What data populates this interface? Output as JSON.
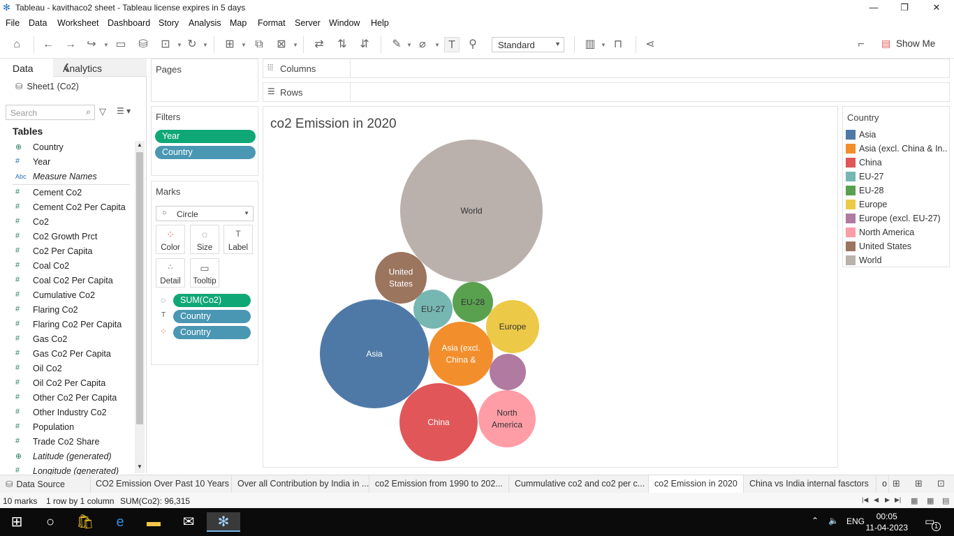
{
  "window": {
    "title": "Tableau - kavithaco2 sheet - Tableau license expires in 5 days"
  },
  "menu": [
    "File",
    "Data",
    "Worksheet",
    "Dashboard",
    "Story",
    "Analysis",
    "Map",
    "Format",
    "Server",
    "Window",
    "Help"
  ],
  "toolbar": {
    "fit_select": "Standard",
    "show_me": "Show Me"
  },
  "data_pane": {
    "tab_data": "Data",
    "tab_analytics": "Analytics",
    "datasource": "Sheet1 (Co2)",
    "search_placeholder": "Search",
    "tables_heading": "Tables",
    "fields": [
      {
        "icon": "globe",
        "name": "Country"
      },
      {
        "icon": "#",
        "name": "Year"
      },
      {
        "icon": "Abc",
        "name": "Measure Names"
      },
      {
        "icon": "#",
        "name": "Cement Co2"
      },
      {
        "icon": "#",
        "name": "Cement Co2 Per Capita"
      },
      {
        "icon": "#",
        "name": "Co2"
      },
      {
        "icon": "#",
        "name": "Co2 Growth Prct"
      },
      {
        "icon": "#",
        "name": "Co2 Per Capita"
      },
      {
        "icon": "#",
        "name": "Coal Co2"
      },
      {
        "icon": "#",
        "name": "Coal Co2 Per Capita"
      },
      {
        "icon": "#",
        "name": "Cumulative Co2"
      },
      {
        "icon": "#",
        "name": "Flaring Co2"
      },
      {
        "icon": "#",
        "name": "Flaring Co2 Per Capita"
      },
      {
        "icon": "#",
        "name": "Gas Co2"
      },
      {
        "icon": "#",
        "name": "Gas Co2 Per Capita"
      },
      {
        "icon": "#",
        "name": "Oil Co2"
      },
      {
        "icon": "#",
        "name": "Oil Co2 Per Capita"
      },
      {
        "icon": "#",
        "name": "Other Co2 Per Capita"
      },
      {
        "icon": "#",
        "name": "Other Industry Co2"
      },
      {
        "icon": "#",
        "name": "Population"
      },
      {
        "icon": "#",
        "name": "Trade Co2 Share"
      },
      {
        "icon": "globe",
        "name": "Latitude (generated)"
      },
      {
        "icon": "#",
        "name": "Longitude (generated)"
      }
    ]
  },
  "shelves": {
    "pages": "Pages",
    "columns": "Columns",
    "rows": "Rows",
    "filters_heading": "Filters",
    "filters": [
      "Year",
      "Country"
    ],
    "marks_heading": "Marks",
    "mark_type": "Circle",
    "mark_buttons": [
      "Color",
      "Size",
      "Label",
      "Detail",
      "Tooltip"
    ],
    "mark_pills": [
      "SUM(Co2)",
      "Country",
      "Country"
    ]
  },
  "viz": {
    "title": "co2 Emission in 2020"
  },
  "legend": {
    "title": "Country",
    "items": [
      {
        "label": "Asia",
        "color": "#4e79a7"
      },
      {
        "label": "Asia (excl. China & In..",
        "color": "#f28e2b"
      },
      {
        "label": "China",
        "color": "#e15759"
      },
      {
        "label": "EU-27",
        "color": "#76b7b2"
      },
      {
        "label": "EU-28",
        "color": "#59a14f"
      },
      {
        "label": "Europe",
        "color": "#edc948"
      },
      {
        "label": "Europe (excl. EU-27)",
        "color": "#b07aa1"
      },
      {
        "label": "North America",
        "color": "#ff9da7"
      },
      {
        "label": "United States",
        "color": "#9c755f"
      },
      {
        "label": "World",
        "color": "#bab0ac"
      }
    ]
  },
  "bubbles": [
    {
      "label": "World",
      "lines": [
        "World"
      ],
      "r": 102,
      "color": "#bab0ac"
    },
    {
      "label": "United States",
      "lines": [
        "United",
        "States"
      ],
      "r": 37,
      "color": "#9c755f"
    },
    {
      "label": "EU-27",
      "lines": [
        "EU-27"
      ],
      "r": 28,
      "color": "#76b7b2"
    },
    {
      "label": "EU-28",
      "lines": [
        "EU-28"
      ],
      "r": 29,
      "color": "#59a14f"
    },
    {
      "label": "Europe",
      "lines": [
        "Europe"
      ],
      "r": 38,
      "color": "#edc948"
    },
    {
      "label": "Asia",
      "lines": [
        "Asia"
      ],
      "r": 78,
      "color": "#4e79a7"
    },
    {
      "label": "Asia (excl. China & In..",
      "lines": [
        "Asia (excl.",
        "China &"
      ],
      "r": 46,
      "color": "#f28e2b"
    },
    {
      "label": "Europe (excl. EU-27)",
      "lines": [],
      "r": 26,
      "color": "#b07aa1"
    },
    {
      "label": "China",
      "lines": [
        "China"
      ],
      "r": 56,
      "color": "#e15759"
    },
    {
      "label": "North America",
      "lines": [
        "North",
        "America"
      ],
      "r": 41,
      "color": "#ff9da7"
    }
  ],
  "sheet_tabs": [
    "Data Source",
    "CO2 Emission Over Past 10 Years",
    "Over all Contribution by India in ...",
    "co2 Emission from 1990 to 202...",
    "Cummulative co2 and co2 per c...",
    "co2 Emission in 2020",
    "China vs India internal fasctors",
    "o"
  ],
  "status": {
    "marks": "10 marks",
    "rows": "1 row by 1 column",
    "sum": "SUM(Co2): 96,315"
  },
  "taskbar": {
    "lang": "ENG",
    "time": "00:05",
    "date": "11-04-2023",
    "notif_count": "1"
  }
}
